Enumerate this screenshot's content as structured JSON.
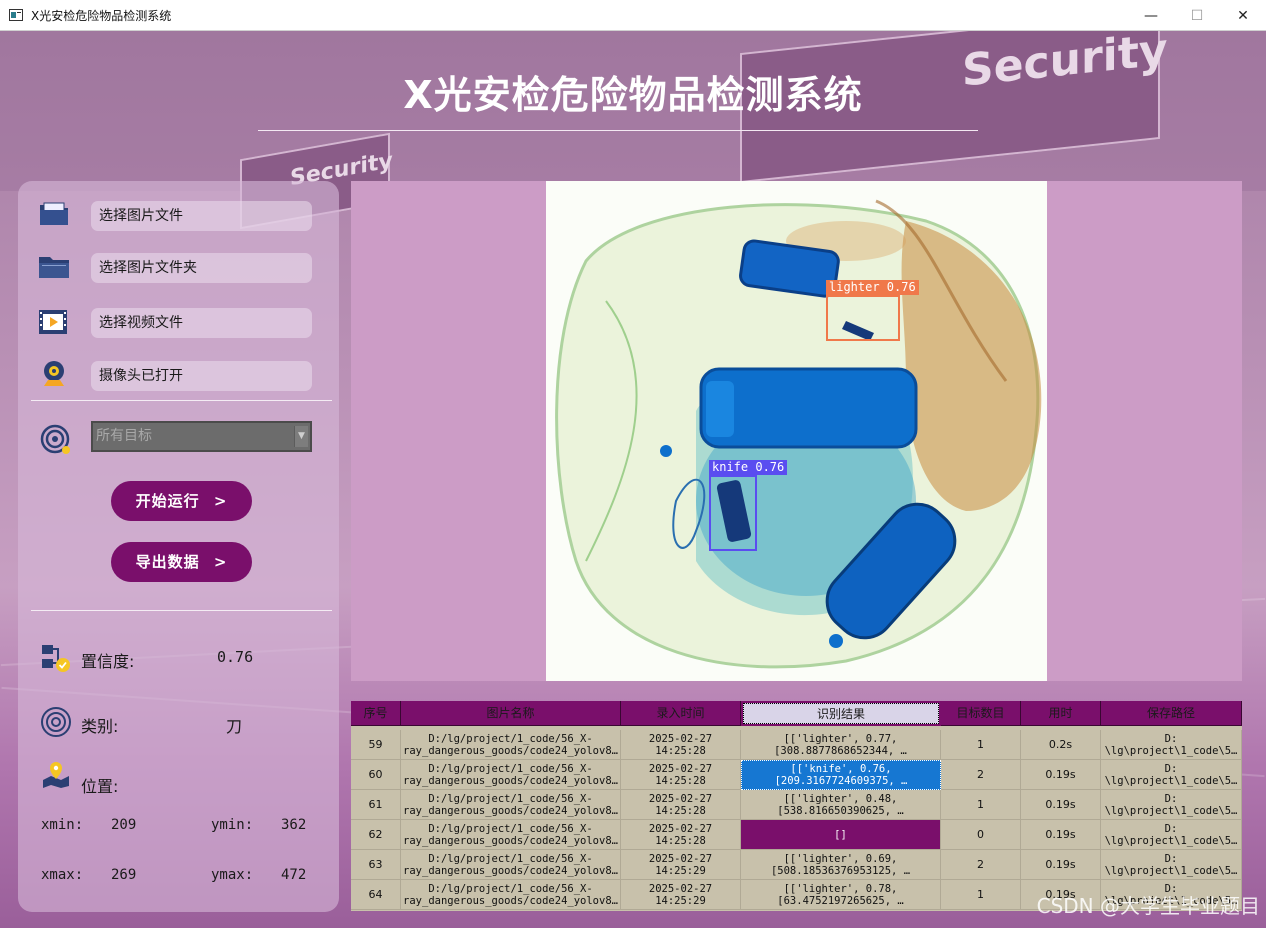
{
  "window": {
    "title": "X光安检危险物品检测系统"
  },
  "header": {
    "title": "X光安检危险物品检测系统"
  },
  "scene": {
    "sign_text": "Security"
  },
  "sidebar": {
    "buttons": [
      {
        "label": "选择图片文件",
        "icon": "image-folder-icon"
      },
      {
        "label": "选择图片文件夹",
        "icon": "folder-icon"
      },
      {
        "label": "选择视频文件",
        "icon": "video-file-icon"
      },
      {
        "label": "摄像头已打开",
        "icon": "camera-icon"
      }
    ],
    "target_select": {
      "value": "所有目标",
      "icon": "target-icon"
    },
    "run_button": "开始运行",
    "export_button": "导出数据",
    "chevron": ">"
  },
  "stats": {
    "confidence_label": "置信度:",
    "confidence_value": "0.76",
    "class_label": "类别:",
    "class_value": "刀",
    "position_label": "位置:",
    "xmin_label": "xmin:",
    "xmin": "209",
    "ymin_label": "ymin:",
    "ymin": "362",
    "xmax_label": "xmax:",
    "xmax": "269",
    "ymax_label": "ymax:",
    "ymax": "472"
  },
  "detections": [
    {
      "label": "lighter 0.76",
      "color": "#f0784a"
    },
    {
      "label": "knife 0.76",
      "color": "#5a4df0"
    }
  ],
  "table": {
    "headers": [
      "序号",
      "图片名称",
      "录入时间",
      "识别结果",
      "目标数目",
      "用时",
      "保存路径"
    ],
    "rows": [
      {
        "id": "59",
        "name1": "D:/lg/project/1_code/56_X-",
        "name2": "ray_dangerous_goods/code24_yolov8…",
        "t1": "2025-02-27",
        "t2": "14:25:28",
        "r1": "[['lighter', 0.77,",
        "r2": "[308.8877868652344, …",
        "count": "1",
        "time": "0.2s",
        "p1": "D:",
        "p2": "\\lg\\project\\1_code\\5…"
      },
      {
        "id": "60",
        "name1": "D:/lg/project/1_code/56_X-",
        "name2": "ray_dangerous_goods/code24_yolov8…",
        "t1": "2025-02-27",
        "t2": "14:25:28",
        "r1": "[['knife', 0.76,",
        "r2": "[209.3167724609375, …",
        "count": "2",
        "time": "0.19s",
        "p1": "D:",
        "p2": "\\lg\\project\\1_code\\5…"
      },
      {
        "id": "61",
        "name1": "D:/lg/project/1_code/56_X-",
        "name2": "ray_dangerous_goods/code24_yolov8…",
        "t1": "2025-02-27",
        "t2": "14:25:28",
        "r1": "[['lighter', 0.48,",
        "r2": "[538.816650390625, …",
        "count": "1",
        "time": "0.19s",
        "p1": "D:",
        "p2": "\\lg\\project\\1_code\\5…"
      },
      {
        "id": "62",
        "name1": "D:/lg/project/1_code/56_X-",
        "name2": "ray_dangerous_goods/code24_yolov8…",
        "t1": "2025-02-27",
        "t2": "14:25:28",
        "r1": "[]",
        "r2": "",
        "count": "0",
        "time": "0.19s",
        "p1": "D:",
        "p2": "\\lg\\project\\1_code\\5…"
      },
      {
        "id": "63",
        "name1": "D:/lg/project/1_code/56_X-",
        "name2": "ray_dangerous_goods/code24_yolov8…",
        "t1": "2025-02-27",
        "t2": "14:25:29",
        "r1": "[['lighter', 0.69,",
        "r2": "[508.18536376953125, …",
        "count": "2",
        "time": "0.19s",
        "p1": "D:",
        "p2": "\\lg\\project\\1_code\\5…"
      },
      {
        "id": "64",
        "name1": "D:/lg/project/1_code/56_X-",
        "name2": "ray_dangerous_goods/code24_yolov8…",
        "t1": "2025-02-27",
        "t2": "14:25:29",
        "r1": "[['lighter', 0.78,",
        "r2": "[63.4752197265625, …",
        "count": "1",
        "time": "0.19s",
        "p1": "D:",
        "p2": "\\lg\\project\\1_code\\5…"
      }
    ]
  },
  "watermark": "CSDN @大学生毕业题目",
  "colors": {
    "accent": "#7a0f6b",
    "selected": "#1677d2",
    "table_bg": "#c8c1ab"
  }
}
